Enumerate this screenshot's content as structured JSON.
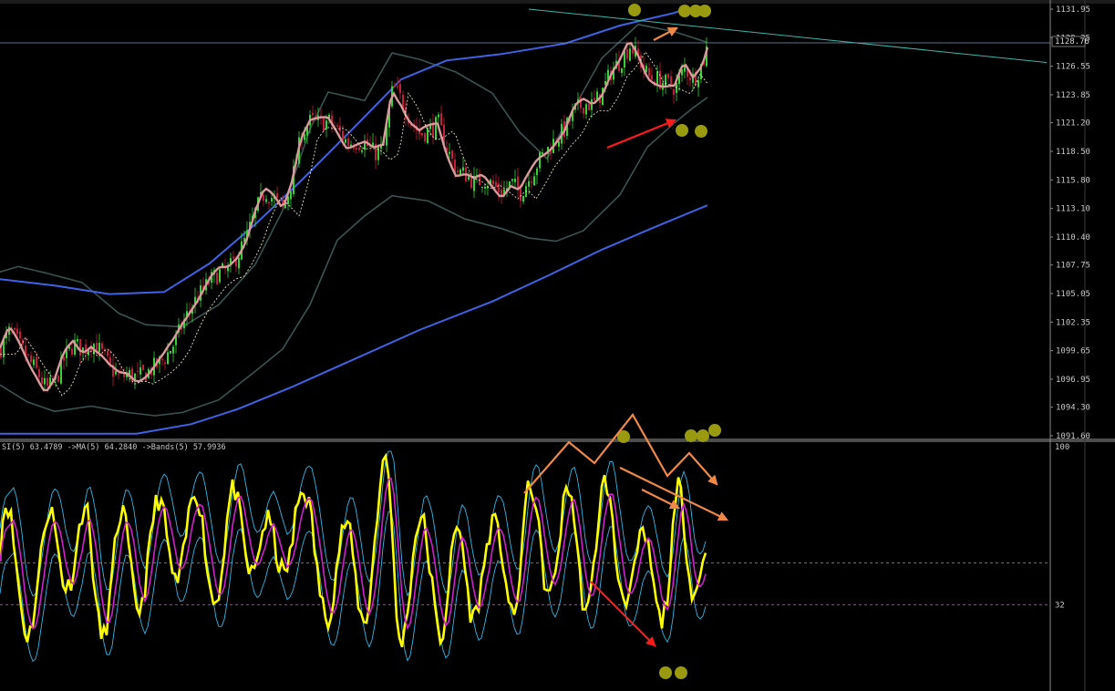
{
  "indicator_label": "SI(5) 63.4789  ->MA(5) 64.2840  ->Bands(5) 57.9936",
  "current_price": "1128.76",
  "colors": {
    "background": "#000000",
    "bull": "#33d433",
    "bear": "#c41e3a",
    "ma_fast": "#d89a9a",
    "ma_long": "#3f63e6",
    "bands": "#3b5451",
    "trendline": "#3fb5a8",
    "osc_main": "#ffff00",
    "osc_ma": "#d020d0",
    "osc_bands": "#30b8e8",
    "markers": "#9a9a10",
    "arrow_orange": "#f08848",
    "arrow_red": "#ff1a1a",
    "level_line": "#b83ab8"
  },
  "chart_data": [
    {
      "type": "line",
      "description_title": "",
      "y_axis_labels": [
        "1131.95",
        "1129.25",
        "1126.55",
        "1123.85",
        "1121.20",
        "1118.50",
        "1115.80",
        "1113.10",
        "1110.40",
        "1107.75",
        "1105.05",
        "1102.35",
        "1099.65",
        "1096.95",
        "1094.30",
        "1091.60"
      ],
      "ylim": [
        1091.6,
        1131.95
      ],
      "grid": false,
      "price_path": [
        [
          0,
          1099.9
        ],
        [
          10,
          1101.5
        ],
        [
          20,
          1100.2
        ],
        [
          30,
          1098.8
        ],
        [
          40,
          1097.6
        ],
        [
          50,
          1096.0
        ],
        [
          60,
          1096.8
        ],
        [
          70,
          1099.0
        ],
        [
          80,
          1100.3
        ],
        [
          90,
          1099.7
        ],
        [
          100,
          1100.5
        ],
        [
          110,
          1099.5
        ],
        [
          120,
          1098.0
        ],
        [
          130,
          1097.1
        ],
        [
          140,
          1097.4
        ],
        [
          150,
          1097.1
        ],
        [
          160,
          1097.6
        ],
        [
          170,
          1098.2
        ],
        [
          180,
          1099.0
        ],
        [
          190,
          1100.3
        ],
        [
          200,
          1102.3
        ],
        [
          210,
          1104.0
        ],
        [
          220,
          1105.2
        ],
        [
          230,
          1106.3
        ],
        [
          240,
          1107.0
        ],
        [
          250,
          1107.3
        ],
        [
          260,
          1108.7
        ],
        [
          270,
          1110.5
        ],
        [
          280,
          1113.0
        ],
        [
          290,
          1114.7
        ],
        [
          300,
          1113.9
        ],
        [
          310,
          1113.0
        ],
        [
          320,
          1116.0
        ],
        [
          330,
          1120.2
        ],
        [
          340,
          1121.4
        ],
        [
          350,
          1121.2
        ],
        [
          360,
          1121.3
        ],
        [
          370,
          1120.4
        ],
        [
          380,
          1119.3
        ],
        [
          390,
          1119.4
        ],
        [
          400,
          1119.2
        ],
        [
          410,
          1118.3
        ],
        [
          420,
          1118.9
        ],
        [
          430,
          1124.6
        ],
        [
          440,
          1123.3
        ],
        [
          450,
          1121.3
        ],
        [
          460,
          1120.1
        ],
        [
          470,
          1120.5
        ],
        [
          480,
          1121.1
        ],
        [
          490,
          1118.6
        ],
        [
          500,
          1116.6
        ],
        [
          510,
          1116.3
        ],
        [
          520,
          1115.5
        ],
        [
          530,
          1115.9
        ],
        [
          540,
          1115.3
        ],
        [
          550,
          1114.6
        ],
        [
          560,
          1115.5
        ],
        [
          570,
          1114.6
        ],
        [
          580,
          1116.0
        ],
        [
          590,
          1117.6
        ],
        [
          600,
          1118.7
        ],
        [
          610,
          1119.8
        ],
        [
          620,
          1120.7
        ],
        [
          630,
          1122.4
        ],
        [
          640,
          1123.0
        ],
        [
          650,
          1122.9
        ],
        [
          660,
          1124.2
        ],
        [
          670,
          1126.2
        ],
        [
          680,
          1127.1
        ],
        [
          690,
          1128.5
        ],
        [
          700,
          1127.2
        ],
        [
          710,
          1125.6
        ],
        [
          720,
          1125.3
        ],
        [
          730,
          1124.9
        ],
        [
          740,
          1124.5
        ],
        [
          750,
          1126.4
        ],
        [
          760,
          1125.3
        ],
        [
          770,
          1126.9
        ],
        [
          776,
          1128.8
        ]
      ],
      "long_ma_path": [
        [
          0,
          1091.8
        ],
        [
          150,
          1091.8
        ],
        [
          210,
          1092.7
        ],
        [
          260,
          1094.1
        ],
        [
          320,
          1096.2
        ],
        [
          390,
          1098.9
        ],
        [
          460,
          1101.6
        ],
        [
          540,
          1104.3
        ],
        [
          600,
          1106.7
        ],
        [
          660,
          1109.2
        ],
        [
          720,
          1111.4
        ],
        [
          776,
          1113.4
        ]
      ],
      "mid_ma_path": [
        [
          0,
          1106.4
        ],
        [
          60,
          1105.8
        ],
        [
          120,
          1105.0
        ],
        [
          180,
          1105.2
        ],
        [
          230,
          1107.9
        ],
        [
          280,
          1111.6
        ],
        [
          330,
          1115.7
        ],
        [
          390,
          1120.9
        ],
        [
          440,
          1125.3
        ],
        [
          490,
          1127.1
        ],
        [
          550,
          1127.7
        ],
        [
          620,
          1128.7
        ],
        [
          680,
          1130.4
        ],
        [
          740,
          1131.6
        ],
        [
          750,
          1131.95
        ]
      ],
      "upper_band_path": [
        [
          0,
          1107.1
        ],
        [
          20,
          1107.6
        ],
        [
          50,
          1107.0
        ],
        [
          90,
          1106.1
        ],
        [
          130,
          1103.2
        ],
        [
          160,
          1102.1
        ],
        [
          200,
          1101.9
        ],
        [
          240,
          1104.0
        ],
        [
          280,
          1107.8
        ],
        [
          310,
          1112.9
        ],
        [
          340,
          1120.6
        ],
        [
          360,
          1124.1
        ],
        [
          400,
          1123.3
        ],
        [
          430,
          1127.8
        ],
        [
          460,
          1127.2
        ],
        [
          500,
          1126.0
        ],
        [
          540,
          1124.0
        ],
        [
          570,
          1120.3
        ],
        [
          600,
          1117.8
        ],
        [
          620,
          1121.1
        ],
        [
          660,
          1127.3
        ],
        [
          700,
          1130.5
        ],
        [
          740,
          1129.8
        ],
        [
          776,
          1128.8
        ]
      ],
      "lower_band_path": [
        [
          0,
          1096.4
        ],
        [
          30,
          1094.8
        ],
        [
          60,
          1093.9
        ],
        [
          100,
          1094.4
        ],
        [
          140,
          1093.8
        ],
        [
          170,
          1093.5
        ],
        [
          200,
          1093.8
        ],
        [
          240,
          1095.0
        ],
        [
          280,
          1097.7
        ],
        [
          310,
          1099.8
        ],
        [
          340,
          1104.0
        ],
        [
          370,
          1110.1
        ],
        [
          400,
          1112.4
        ],
        [
          430,
          1114.3
        ],
        [
          470,
          1113.8
        ],
        [
          510,
          1112.1
        ],
        [
          550,
          1111.2
        ],
        [
          580,
          1110.3
        ],
        [
          610,
          1110.0
        ],
        [
          640,
          1111.0
        ],
        [
          680,
          1114.4
        ],
        [
          710,
          1118.9
        ],
        [
          740,
          1121.2
        ],
        [
          760,
          1122.6
        ],
        [
          776,
          1123.6
        ]
      ],
      "trendline": [
        [
          580,
          1131.95
        ],
        [
          1148,
          1126.9
        ]
      ],
      "horizontal_line": 1128.76
    },
    {
      "type": "line",
      "y_axis_labels": [
        "100",
        "32"
      ],
      "ylim": [
        0,
        100
      ],
      "level_lines": [
        50,
        32
      ],
      "grid": false
    }
  ]
}
